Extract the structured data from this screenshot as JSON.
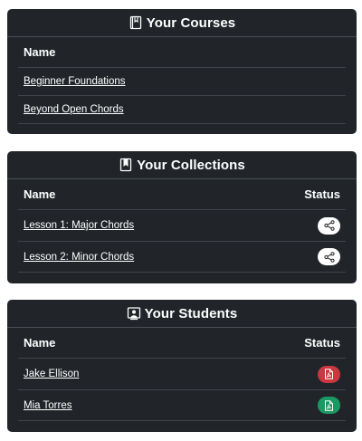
{
  "courses": {
    "title": "Your Courses",
    "icon": "book-icon",
    "col_name": "Name",
    "items": [
      {
        "name": "Beginner Foundations"
      },
      {
        "name": "Beyond Open Chords"
      }
    ]
  },
  "collections": {
    "title": "Your Collections",
    "icon": "bookmark-icon",
    "col_name": "Name",
    "col_status": "Status",
    "items": [
      {
        "name": "Lesson 1: Major Chords",
        "status_icon": "share-icon"
      },
      {
        "name": "Lesson 2: Minor Chords",
        "status_icon": "share-icon"
      }
    ]
  },
  "students": {
    "title": "Your Students",
    "icon": "student-board-icon",
    "col_name": "Name",
    "col_status": "Status",
    "items": [
      {
        "name": "Jake Ellison",
        "status_icon": "pdf-file-icon",
        "status_color": "#c9373f"
      },
      {
        "name": "Mia Torres",
        "status_icon": "pdf-file-icon",
        "status_color": "#1a9a62"
      }
    ]
  }
}
